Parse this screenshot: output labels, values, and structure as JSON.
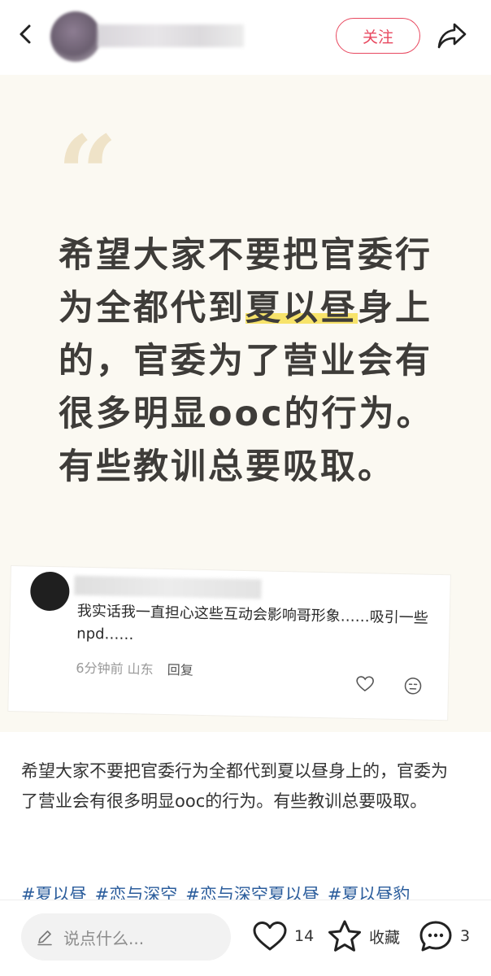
{
  "header": {
    "follow_label": "关注"
  },
  "card": {
    "quote_mark": "“",
    "quote_parts": [
      "希望大家不要把官委行为全都代到",
      "夏以昼",
      "身上的，官委为了营业会有很多明显ooc的行为。有些教训总要吸取。"
    ],
    "highlight_color": "#f7e36a",
    "comment": {
      "text": "我实话我一直担心这些互动会影响哥形象……吸引一些npd……",
      "time": "6分钟前",
      "location": "山东",
      "reply_label": "回复"
    }
  },
  "post": {
    "text": "希望大家不要把官委行为全都代到夏以昼身上的，官委为了营业会有很多明显ooc的行为。有些教训总要吸取。",
    "tags": [
      "#夏以昼",
      "#恋与深空",
      "#恋与深空夏以昼",
      "#夏以昼豹"
    ]
  },
  "bottom": {
    "input_placeholder": "说点什么...",
    "like_count": "14",
    "favorite_label": "收藏",
    "comment_count": "3"
  },
  "colors": {
    "accent": "#e8485f",
    "tag": "#2b5d9c",
    "card_bg": "#fbf9f2"
  },
  "icons": [
    "back-icon",
    "share-icon",
    "heart-icon",
    "star-icon",
    "comment-icon",
    "pen-icon",
    "meh-face-icon"
  ]
}
